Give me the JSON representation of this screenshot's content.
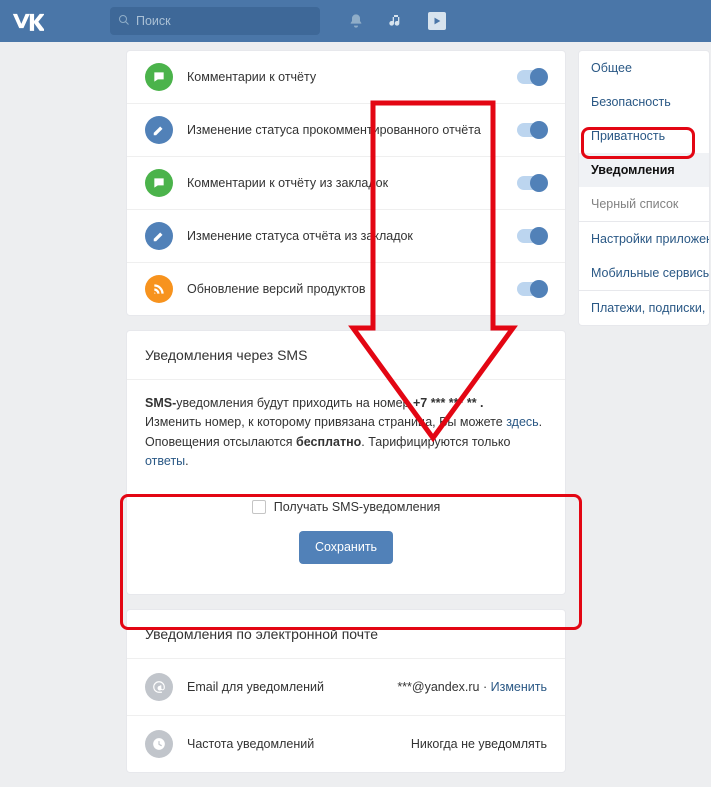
{
  "search": {
    "placeholder": "Поиск"
  },
  "rows": {
    "r0": "Комментарии к отчёту",
    "r1": "Изменение статуса прокомментированного отчёта",
    "r2": "Комментарии к отчёту из закладок",
    "r3": "Изменение статуса отчёта из закладок",
    "r4": "Обновление версий продуктов"
  },
  "sms": {
    "title": "Уведомления через SMS",
    "body_prefix": "SMS-",
    "body1a": "уведомления будут приходить на номер ",
    "body1_num": "+7 *** *** ** .",
    "body2a": "Изменить номер, к которому привязана страница, Вы можете ",
    "body2_link": "здесь",
    "body3a": "Оповещения отсылаются ",
    "body3_bold": "бесплатно",
    "body3b": ". Тарифицируются только ",
    "body3_link": "ответы",
    "checkbox": "Получать SMS-уведомления",
    "save": "Сохранить"
  },
  "email": {
    "title": "Уведомления по электронной почте",
    "row1_label": "Email для уведомлений",
    "row1_value": "***@yandex.ru",
    "row1_action": "Изменить",
    "row2_label": "Частота уведомлений",
    "row2_value": "Никогда не уведомлять"
  },
  "sidebar": {
    "i0": "Общее",
    "i1": "Безопасность",
    "i2": "Приватность",
    "i3": "Уведомления",
    "i4": "Черный список",
    "i5": "Настройки приложений",
    "i6": "Мобильные сервисы",
    "i7": "Платежи, подписки, переводы"
  }
}
